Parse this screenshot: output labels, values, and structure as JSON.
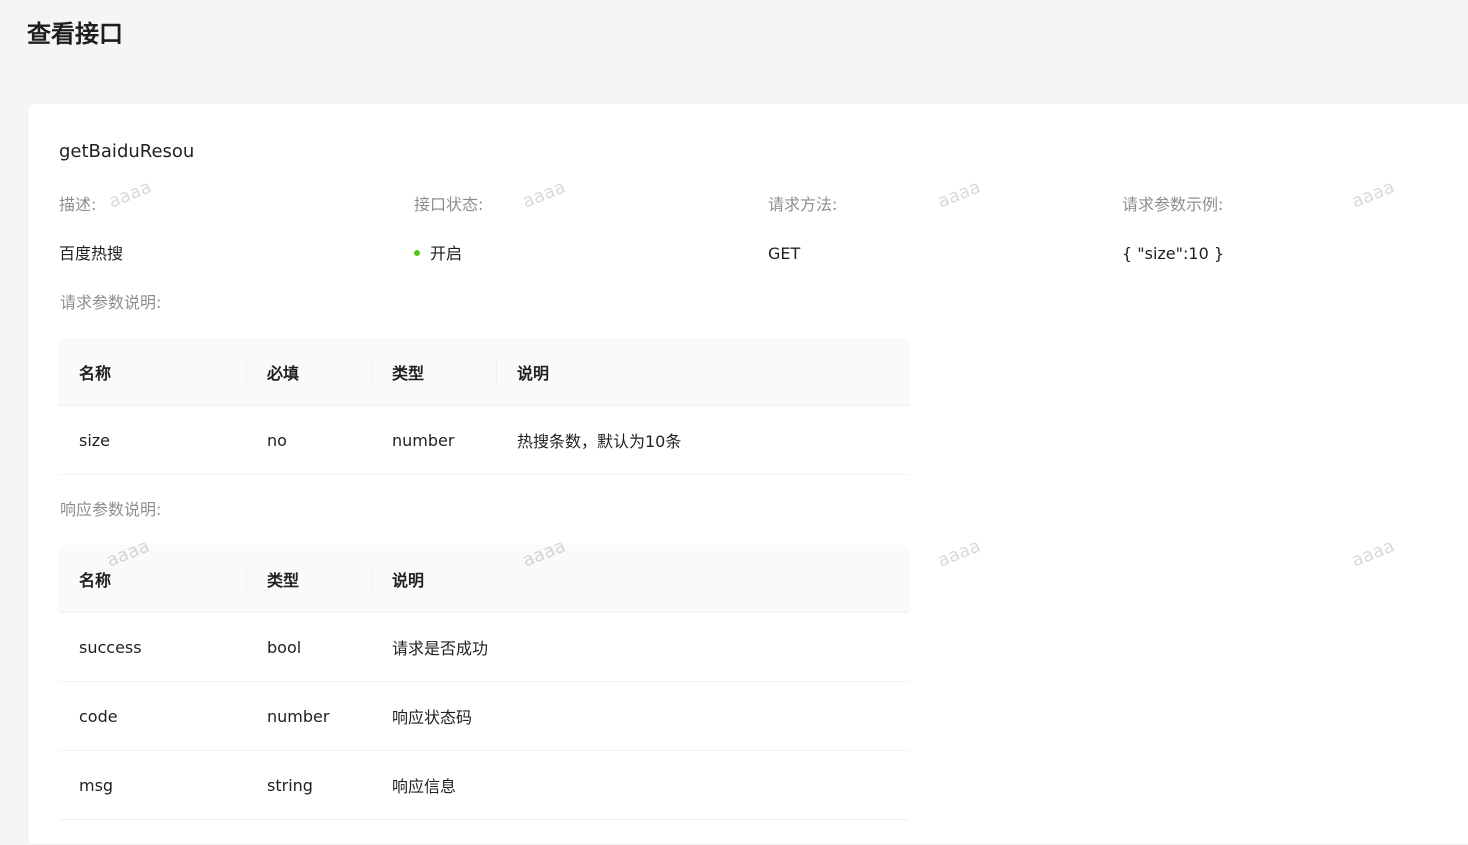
{
  "page": {
    "title": "查看接口"
  },
  "api": {
    "name": "getBaiduResou",
    "descriptions": [
      {
        "label": "描述:",
        "value": "百度热搜"
      },
      {
        "label": "接口状态:",
        "value": "开启",
        "status_color": "#52c41a"
      },
      {
        "label": "请求方法:",
        "value": "GET"
      },
      {
        "label": "请求参数示例:",
        "value": "{ \"size\":10 }"
      }
    ],
    "request_params": {
      "label": "请求参数说明:",
      "columns": [
        "名称",
        "必填",
        "类型",
        "说明"
      ],
      "rows": [
        [
          "size",
          "no",
          "number",
          "热搜条数，默认为10条"
        ]
      ]
    },
    "response_params": {
      "label": "响应参数说明:",
      "columns": [
        "名称",
        "类型",
        "说明"
      ],
      "rows": [
        [
          "success",
          "bool",
          "请求是否成功"
        ],
        [
          "code",
          "number",
          "响应状态码"
        ],
        [
          "msg",
          "string",
          "响应信息"
        ]
      ]
    }
  },
  "watermark": {
    "text": "aaaa"
  }
}
